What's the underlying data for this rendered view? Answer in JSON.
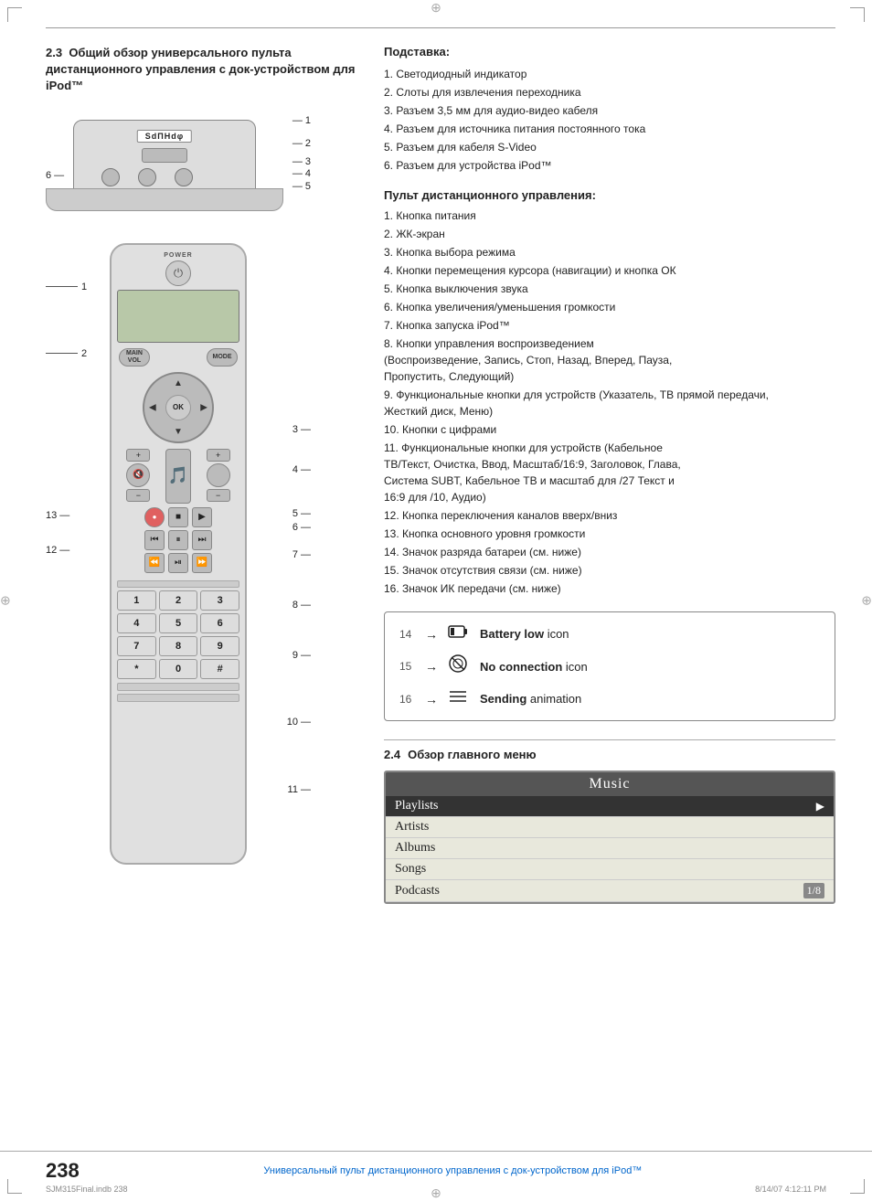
{
  "page": {
    "number": "238",
    "footer_text": "Универсальный пульт дистанционного управления с док-устройством для iPod™",
    "file_info": "SJM315Final.indb   238",
    "date_info": "8/14/07   4:12:11 PM"
  },
  "section_23": {
    "number": "2.3",
    "title": "Общий обзор универсального пульта дистанционного управления с док-устройством для iPod™"
  },
  "dock_labels": {
    "brand": "SdΠΗdφ",
    "items": [
      {
        "num": "1",
        "text": ""
      },
      {
        "num": "2",
        "text": ""
      },
      {
        "num": "3",
        "text": ""
      },
      {
        "num": "4",
        "text": ""
      },
      {
        "num": "5",
        "text": ""
      },
      {
        "num": "6",
        "text": ""
      }
    ]
  },
  "remote_labels": {
    "power_text": "POWER",
    "main_vol_text": "MAIN\nVOL",
    "mode_text": "MODE",
    "ok_text": "OK",
    "numbers": [
      "1",
      "2",
      "3",
      "4",
      "5",
      "6",
      "7",
      "8",
      "9",
      "*",
      "0",
      "#"
    ]
  },
  "right_column": {
    "dock_section_title": "Подставка:",
    "dock_items": [
      {
        "num": "1",
        "text": "Светодиодный индикатор"
      },
      {
        "num": "2",
        "text": "Слоты для извлечения переходника"
      },
      {
        "num": "3",
        "text": "Разъем 3,5 мм для аудио-видео кабеля"
      },
      {
        "num": "4",
        "text": "Разъем для источника питания постоянного тока"
      },
      {
        "num": "5",
        "text": "Разъем для кабеля S-Video"
      },
      {
        "num": "6",
        "text": "Разъем для устройства iPod™"
      }
    ],
    "remote_section_title": "Пульт дистанционного управления:",
    "remote_items": [
      {
        "num": "1",
        "text": "Кнопка питания"
      },
      {
        "num": "2",
        "text": "ЖК-экран"
      },
      {
        "num": "3",
        "text": "Кнопка выбора режима"
      },
      {
        "num": "4",
        "text": "Кнопки перемещения курсора (навигации) и кнопка ОК"
      },
      {
        "num": "5",
        "text": "Кнопка выключения звука"
      },
      {
        "num": "6",
        "text": "Кнопка увеличения/уменьшения громкости"
      },
      {
        "num": "7",
        "text": "Кнопка запуска iPod™"
      },
      {
        "num": "8",
        "text": "Кнопки управления воспроизведением (Воспроизведение, Запись, Стоп, Назад, Вперед, Пауза, Пропустить, Следующий)"
      },
      {
        "num": "9",
        "text": "Функциональные кнопки для устройств (Указатель, ТВ прямой передачи, Жесткий диск, Меню)"
      },
      {
        "num": "10",
        "text": "Кнопки с цифрами"
      },
      {
        "num": "11",
        "text": "Функциональные кнопки для устройств (Кабельное ТВ/Текст, Очистка, Ввод, Масштаб/16:9, Заголовок, Глава, Система SUBT, Кабельное ТВ и масштаб для /27 Текст и 16:9 для /10, Аудио)"
      },
      {
        "num": "12",
        "text": "Кнопка переключения каналов вверх/вниз"
      },
      {
        "num": "13",
        "text": "Кнопка основного уровня громкости"
      },
      {
        "num": "14",
        "text": "Значок разряда батареи (см. ниже)"
      },
      {
        "num": "15",
        "text": "Значок отсутствия связи (см. ниже)"
      },
      {
        "num": "16",
        "text": "Значок ИК передачи (см. ниже)"
      }
    ]
  },
  "icons_box": {
    "items": [
      {
        "num": "14",
        "icon": "battery",
        "label_bold": "Battery low",
        "label_rest": " icon"
      },
      {
        "num": "15",
        "icon": "no-connection",
        "label_bold": "No connection",
        "label_rest": " icon"
      },
      {
        "num": "16",
        "icon": "sending",
        "label_bold": "Sending",
        "label_rest": " animation"
      }
    ]
  },
  "section_24": {
    "number": "2.4",
    "title": "Обзор главного меню",
    "menu": {
      "title": "Music",
      "items": [
        {
          "label": "Playlists",
          "selected": true,
          "has_arrow": true
        },
        {
          "label": "Artists",
          "selected": false
        },
        {
          "label": "Albums",
          "selected": false
        },
        {
          "label": "Songs",
          "selected": false
        },
        {
          "label": "Podcasts",
          "selected": false,
          "page_indicator": "1/8"
        }
      ]
    }
  }
}
